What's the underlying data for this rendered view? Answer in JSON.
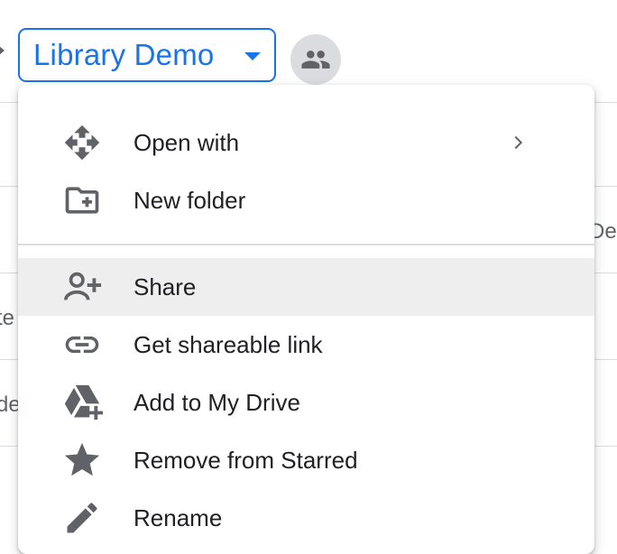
{
  "breadcrumb": {
    "current_folder": "Library Demo"
  },
  "background": {
    "fragment_right": "De",
    "fragment_left_1": "te",
    "fragment_left_2": "de"
  },
  "context_menu": {
    "items": [
      {
        "label": "Open with",
        "icon": "move-arrows-icon",
        "has_submenu": true
      },
      {
        "label": "New folder",
        "icon": "new-folder-icon"
      },
      {
        "label": "Share",
        "icon": "add-person-icon",
        "highlighted": true
      },
      {
        "label": "Get shareable link",
        "icon": "link-icon"
      },
      {
        "label": "Add to My Drive",
        "icon": "add-to-drive-icon"
      },
      {
        "label": "Remove from Starred",
        "icon": "star-icon"
      },
      {
        "label": "Rename",
        "icon": "pencil-icon"
      }
    ]
  },
  "colors": {
    "accent": "#1a73e8",
    "icon": "#5f6368",
    "text": "#202124",
    "hover_background": "#eeeeee",
    "divider": "#dadce0"
  }
}
